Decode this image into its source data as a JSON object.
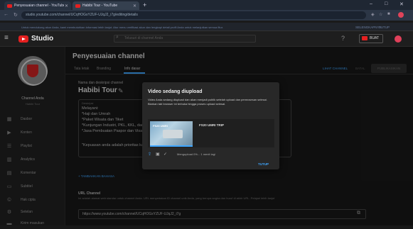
{
  "browser": {
    "tabs": [
      {
        "label": "Penyesuaian channel - YouTube Studio"
      },
      {
        "label": "Habibi Tour - YouTube"
      }
    ],
    "new_tab": "+",
    "address": "studio.youtube.com/channel/UCqHOGsYZUF-UJqJ2_i7g/editing/details",
    "window_controls": [
      "–",
      "□",
      "✕"
    ],
    "info_bar_text": "Untuk mendukung akun Anda, kami membutuhkan informasi lebih lanjut. Atur menu verifikasi akun dan lengkapi detail profil Anda untuk melanjutkan semua fitur.",
    "info_more": "SELENGKAPNYA",
    "info_close": "TUTUP"
  },
  "studio": {
    "logo_text": "Studio",
    "search_placeholder": "Telusuri di channel Anda",
    "create_label": "BUAT"
  },
  "sidebar": {
    "channel_label": "Channel Anda",
    "channel_sub": "Habibi Tour",
    "items": [
      {
        "label": "Dasbor",
        "icon": "dashboard-icon"
      },
      {
        "label": "Konten",
        "icon": "content-icon"
      },
      {
        "label": "Playlist",
        "icon": "playlist-icon"
      },
      {
        "label": "Analytics",
        "icon": "analytics-icon"
      },
      {
        "label": "Komentar",
        "icon": "comments-icon"
      },
      {
        "label": "Subtitel",
        "icon": "subtitles-icon"
      },
      {
        "label": "Hak cipta",
        "icon": "copyright-icon"
      },
      {
        "label": "Setelan",
        "icon": "settings-icon"
      },
      {
        "label": "Kirim masukan",
        "icon": "feedback-icon"
      }
    ]
  },
  "main": {
    "title": "Penyesuaian channel",
    "tabs": [
      "Tata letak",
      "Branding",
      "Info dasar"
    ],
    "actions": {
      "cancel": "LIHAT CHANNEL",
      "undo": "BATAL",
      "publish": "PUBLIKASIKAN"
    },
    "name_label": "Nama dan deskripsi channel",
    "channel_name": "Habibi Tour",
    "desc_label": "Deskripsi",
    "desc_lines": [
      "Melayani:",
      "*Haji dan Umrah",
      "*Paket Wisata dan Tiket",
      "*Kunjungan Industri, PKL, KKL, dan Studi Banding",
      "*Jasa Pembuatan Paspor dan Visa",
      "",
      "\"Kepuasan anda adalah prioritas kami\""
    ],
    "add_language": "+ TAMBAHKAN BAHASA",
    "url_label": "URL Channel",
    "url_desc": "Ini adalah alamat web standar untuk channel Anda. URL menyertakan ID channel unik Anda, yang berupa angka dan huruf di akhir URL. Pelajari lebih lanjut",
    "url_value": "https://www.youtube.com/channel/UCqHOGsYZUF-UJqJ2_i7g"
  },
  "dialog": {
    "title": "Video sedang diupload",
    "text": "Video Anda sedang diupload dan akan menjadi publik setelah upload dan pemrosesan selesai. Biarkan tab browser ini terbuka hingga proses upload selesai.",
    "video_title": "FS20 UMRI TRIP",
    "thumb_text": "FS20 UMRI",
    "status": "Mengupload 0%... 1 menit lagi",
    "close": "TUTUP"
  },
  "colors": {
    "accent": "#3ea6ff",
    "brand": "#e52020"
  }
}
